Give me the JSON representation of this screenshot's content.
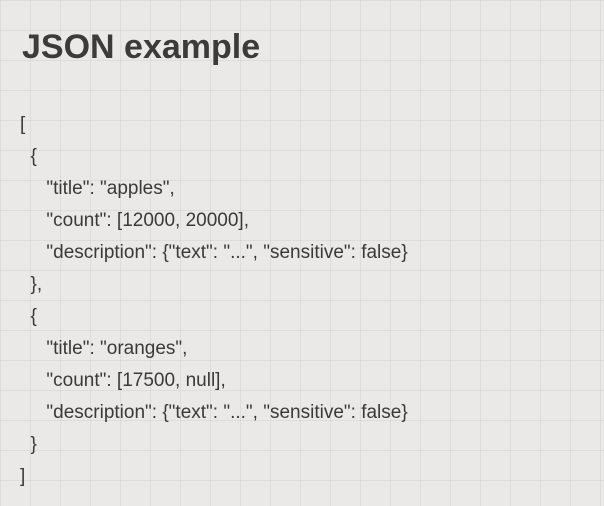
{
  "heading": "JSON example",
  "code": {
    "line1": "[",
    "line2": "  {",
    "line3": "     \"title\": \"apples\",",
    "line4": "     \"count\": [12000, 20000],",
    "line5": "     \"description\": {\"text\": \"...\", \"sensitive\": false}",
    "line6": "  },",
    "line7": "  {",
    "line8": "     \"title\": \"oranges\",",
    "line9": "     \"count\": [17500, null],",
    "line10": "     \"description\": {\"text\": \"...\", \"sensitive\": false}",
    "line11": "  }",
    "line12": "]"
  }
}
